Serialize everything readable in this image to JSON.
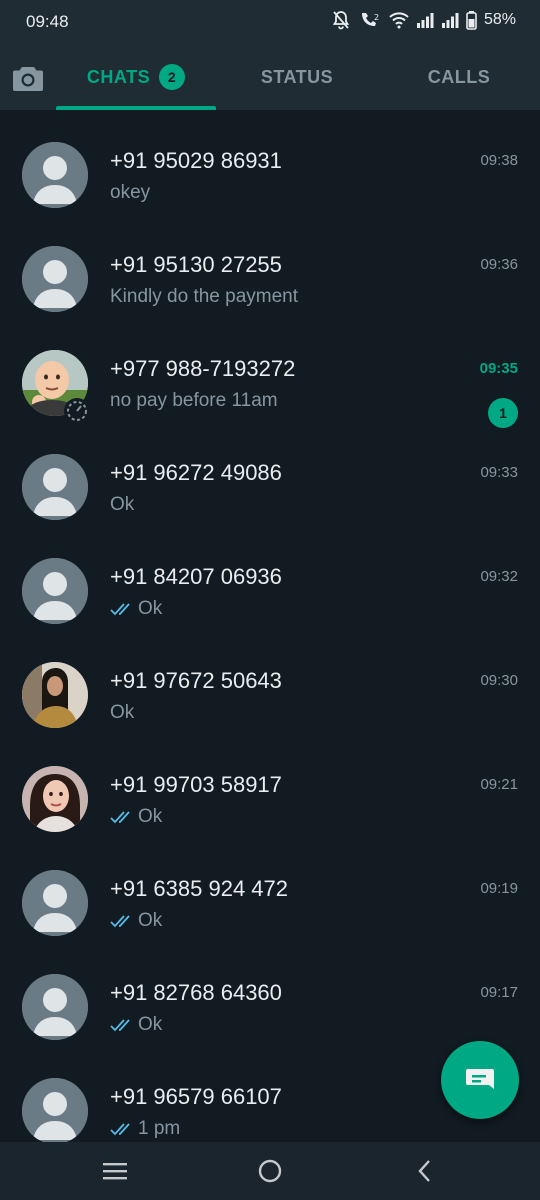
{
  "status_bar": {
    "time": "09:48",
    "battery": "58%"
  },
  "tabs": [
    {
      "label": "CHATS",
      "badge": "2",
      "active": true
    },
    {
      "label": "STATUS",
      "active": false
    },
    {
      "label": "CALLS",
      "active": false
    }
  ],
  "chats": [
    {
      "name": "+91 95029 86931",
      "preview": "okey",
      "time": "09:38",
      "read_ticks": false,
      "unread": false,
      "avatar": "default"
    },
    {
      "name": "+91 95130 27255",
      "preview": "Kindly do the payment",
      "time": "09:36",
      "read_ticks": false,
      "unread": false,
      "avatar": "default"
    },
    {
      "name": "+977 988-7193272",
      "preview": "no pay before 11am",
      "time": "09:35",
      "read_ticks": false,
      "unread": true,
      "unread_count": "1",
      "avatar": "baby-photo"
    },
    {
      "name": "+91 96272 49086",
      "preview": "Ok",
      "time": "09:33",
      "read_ticks": false,
      "unread": false,
      "avatar": "default"
    },
    {
      "name": "+91 84207 06936",
      "preview": "Ok",
      "time": "09:32",
      "read_ticks": true,
      "unread": false,
      "avatar": "default"
    },
    {
      "name": "+91 97672 50643",
      "preview": "Ok",
      "time": "09:30",
      "read_ticks": false,
      "unread": false,
      "avatar": "woman-photo"
    },
    {
      "name": "+91 99703 58917",
      "preview": "Ok",
      "time": "09:21",
      "read_ticks": true,
      "unread": false,
      "avatar": "woman-photo-2"
    },
    {
      "name": "+91 6385 924 472",
      "preview": "Ok",
      "time": "09:19",
      "read_ticks": true,
      "unread": false,
      "avatar": "default"
    },
    {
      "name": "+91 82768 64360",
      "preview": "Ok",
      "time": "09:17",
      "read_ticks": true,
      "unread": false,
      "avatar": "default"
    },
    {
      "name": "+91 96579 66107",
      "preview": "1 pm",
      "time": "",
      "read_ticks": true,
      "unread": false,
      "avatar": "default"
    }
  ],
  "colors": {
    "accent": "#00a884",
    "background": "#121b22",
    "header": "#1f2c34",
    "read_tick": "#53bdeb"
  }
}
